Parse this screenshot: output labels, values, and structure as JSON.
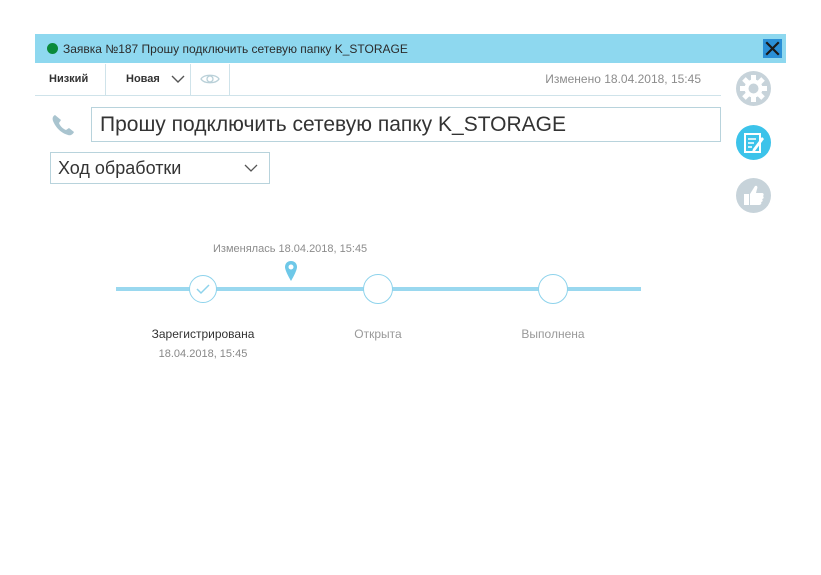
{
  "header": {
    "status_color": "#0a8a3a",
    "title": "Заявка №187 Прошу подключить сетевую папку K_STORAGE",
    "close_icon": "close-icon"
  },
  "infobar": {
    "priority": "Низкий",
    "state": "Новая",
    "watch_icon": "eye-icon",
    "modified": "Изменено 18.04.2018, 15:45"
  },
  "subject": {
    "icon": "phone-icon",
    "value": "Прошу подключить сетевую папку K_STORAGE"
  },
  "view": {
    "selected": "Ход обработки"
  },
  "sidebar": {
    "buttons": [
      {
        "icon": "gear-icon"
      },
      {
        "icon": "edit-icon"
      },
      {
        "icon": "thumbs-up-icon"
      }
    ]
  },
  "timeline": {
    "changed_note": "Изменялась 18.04.2018, 15:45",
    "stages": [
      {
        "label": "Зарегистрирована",
        "date": "18.04.2018, 15:45",
        "done": true
      },
      {
        "label": "Открыта",
        "date": "",
        "done": false
      },
      {
        "label": "Выполнена",
        "date": "",
        "done": false
      }
    ]
  },
  "colors": {
    "accent": "#8ed8ef",
    "close_bg": "#2a8fd6",
    "track": "#9ad8ef",
    "side_active": "#3cc3ea",
    "side_inactive": "#c7d3da"
  }
}
